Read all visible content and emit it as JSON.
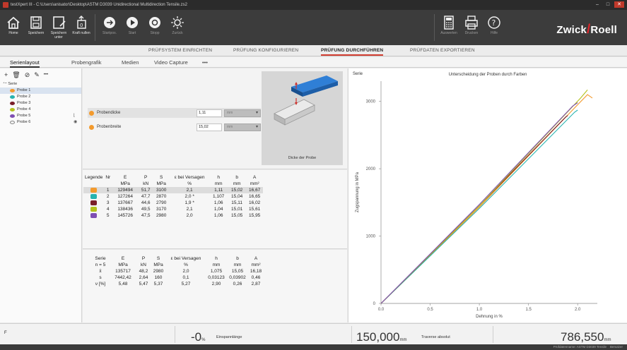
{
  "window": {
    "title": "testXpert III - C:\\Users\\anisator\\Desktop\\ASTM D3039 Unidirectional Multidirection Tensile.zs2"
  },
  "ribbon": {
    "buttons": [
      {
        "id": "home",
        "label": "Home",
        "icon": "home-icon"
      },
      {
        "id": "save",
        "label": "Speichern",
        "icon": "save-icon"
      },
      {
        "id": "saveas",
        "label": "Speichern unter",
        "icon": "save-as-icon"
      },
      {
        "id": "force",
        "label": "Kraft nullen",
        "icon": "force-zero-icon"
      },
      {
        "id": "startpos",
        "label": "Startpos.",
        "icon": "start-position-icon"
      },
      {
        "id": "start",
        "label": "Start",
        "icon": "play-icon"
      },
      {
        "id": "stop",
        "label": "Stopp",
        "icon": "stop-icon"
      },
      {
        "id": "back",
        "label": "Zurück",
        "icon": "return-icon"
      },
      {
        "id": "evaluate",
        "label": "Auswerten",
        "icon": "calculator-icon"
      },
      {
        "id": "print",
        "label": "Drucken",
        "icon": "printer-icon"
      },
      {
        "id": "help",
        "label": "Hilfe",
        "icon": "help-icon"
      }
    ],
    "logo_left": "Zwick",
    "logo_right": "Roell"
  },
  "main_tabs": [
    {
      "label": "PRÜFSYSTEM EINRICHTEN",
      "active": false
    },
    {
      "label": "PRÜFUNG KONFIGURIEREN",
      "active": false
    },
    {
      "label": "PRÜFUNG DURCHFÜHREN",
      "active": true
    },
    {
      "label": "PRÜFDATEN EXPORTIEREN",
      "active": false
    }
  ],
  "sub_tabs": [
    {
      "label": "Serienlayout",
      "active": true
    },
    {
      "label": "Probengrafik",
      "active": false
    },
    {
      "label": "Medien",
      "active": false
    },
    {
      "label": "Video Capture",
      "active": false
    },
    {
      "label": "•••",
      "active": false
    }
  ],
  "tree": {
    "root": "Serie",
    "items": [
      {
        "label": "Probe 1",
        "color": "#f39a2d",
        "selected": true,
        "mark": ""
      },
      {
        "label": "Probe 2",
        "color": "#27b3b0",
        "selected": false,
        "mark": ""
      },
      {
        "label": "Probe 3",
        "color": "#7a1e2a",
        "selected": false,
        "mark": ""
      },
      {
        "label": "Probe 4",
        "color": "#b4c21d",
        "selected": false,
        "mark": ""
      },
      {
        "label": "Probe 5",
        "color": "#7e4fb3",
        "selected": false,
        "mark": "⌊"
      },
      {
        "label": "Probe 6",
        "color": "#f4f4f4",
        "selected": false,
        "mark": "◉"
      }
    ]
  },
  "params": [
    {
      "label": "Probendicke",
      "value": "1,11",
      "unit": "mm"
    },
    {
      "label": "Probenbreite",
      "value": "15,02",
      "unit": "mm"
    }
  ],
  "preview": {
    "caption": "Dicke der Probe"
  },
  "results": {
    "header1": [
      "Legende",
      "Nr",
      "E",
      "P",
      "S",
      "ε bei Versagen",
      "h",
      "b",
      "A"
    ],
    "header2": [
      "",
      "",
      "MPa",
      "kN",
      "MPa",
      "%",
      "mm",
      "mm",
      "mm²"
    ],
    "rows": [
      {
        "color": "#f39a2d",
        "cells": [
          "1",
          "129494",
          "51,7",
          "3100",
          "2,1",
          "1,11",
          "15,02",
          "16,67"
        ]
      },
      {
        "color": "#27b3b0",
        "cells": [
          "2",
          "127264",
          "47,7",
          "2870",
          "2,0 *",
          "1,107",
          "15,04",
          "16,65"
        ]
      },
      {
        "color": "#7a1e2a",
        "cells": [
          "3",
          "137667",
          "44,6",
          "2790",
          "1,9 *",
          "1,06",
          "15,11",
          "16,02"
        ]
      },
      {
        "color": "#b4c21d",
        "cells": [
          "4",
          "138436",
          "49,5",
          "3170",
          "2,1",
          "1,04",
          "15,01",
          "15,61"
        ]
      },
      {
        "color": "#7e4fb3",
        "cells": [
          "5",
          "145726",
          "47,5",
          "2980",
          "2,0",
          "1,06",
          "15,05",
          "15,95"
        ]
      }
    ]
  },
  "stats": {
    "header1": [
      "Serie",
      "E",
      "P",
      "S",
      "ε bei Versagen",
      "h",
      "b",
      "A"
    ],
    "header2": [
      "n = 5",
      "MPa",
      "kN",
      "MPa",
      "%",
      "mm",
      "mm",
      "mm²"
    ],
    "rows": [
      [
        "x̄",
        "135717",
        "48,2",
        "2980",
        "2,0",
        "1,075",
        "15,05",
        "16,18"
      ],
      [
        "s",
        "7442,42",
        "2,64",
        "160",
        "0,1",
        "0,03123",
        "0,03902",
        "0,46"
      ],
      [
        "ν [%]",
        "5,48",
        "5,47",
        "5,37",
        "5,27",
        "2,90",
        "0,26",
        "2,87"
      ]
    ]
  },
  "chart_data": {
    "type": "line",
    "corner_label": "Serie",
    "title": "Unterscheidung der Proben durch Farben",
    "xlabel": "Dehnung in %",
    "ylabel": "Zugspannung in MPa",
    "xlim": [
      0,
      2.2
    ],
    "ylim": [
      0,
      3300
    ],
    "xticks": [
      "0.0",
      "0.5",
      "1.0",
      "1.5",
      "2.0"
    ],
    "xtick_values": [
      0,
      0.5,
      1.0,
      1.5,
      2.0
    ],
    "yticks": [
      "0",
      "1000",
      "2000",
      "3000"
    ],
    "ytick_values": [
      0,
      1000,
      2000,
      3000
    ],
    "series": [
      {
        "color": "#f39a2d",
        "x": [
          0,
          1.0,
          2.0,
          2.1,
          2.15
        ],
        "y": [
          0,
          1430,
          2950,
          3100,
          3050
        ]
      },
      {
        "color": "#27b3b0",
        "x": [
          0,
          1.0,
          1.97,
          2.0
        ],
        "y": [
          0,
          1410,
          2840,
          2870
        ]
      },
      {
        "color": "#7a1e2a",
        "x": [
          0,
          1.0,
          1.88,
          1.9
        ],
        "y": [
          0,
          1450,
          2770,
          2790
        ]
      },
      {
        "color": "#b4c21d",
        "x": [
          0,
          1.0,
          2.03,
          2.1
        ],
        "y": [
          0,
          1450,
          3050,
          3170
        ]
      },
      {
        "color": "#7e4fb3",
        "x": [
          0,
          1.0,
          1.95,
          2.0
        ],
        "y": [
          0,
          1470,
          2930,
          2980
        ]
      }
    ]
  },
  "status": {
    "left_label": "F",
    "value1": "-0",
    "unit1": "%",
    "label1": "Einspannlänge",
    "value2": "150,000",
    "unit2": "mm",
    "label2": "Traverse absolut",
    "value3": "786,550",
    "unit3": "mm",
    "footer_left": "Prüfdatenname: ASTM D3039 Tensile",
    "footer_right": "Benutzer"
  }
}
